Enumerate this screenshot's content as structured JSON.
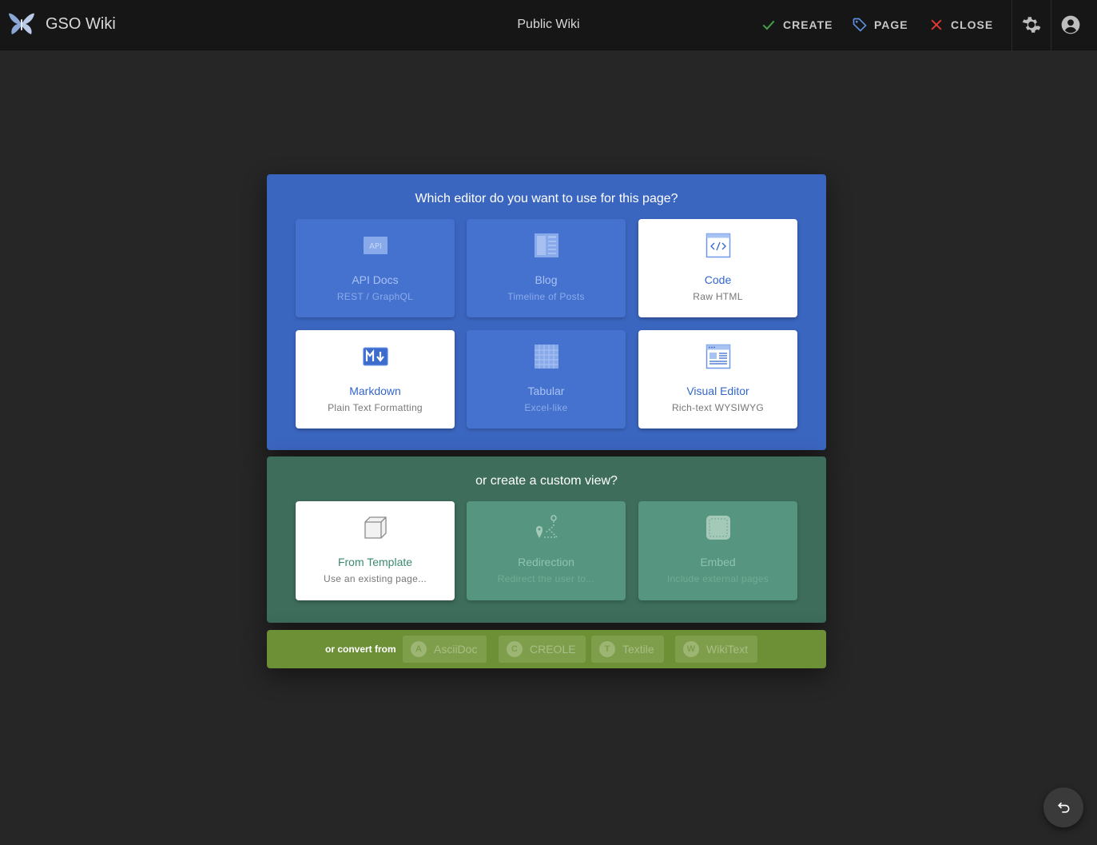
{
  "header": {
    "app_title": "GSO Wiki",
    "page_title": "Public Wiki",
    "create_label": "CREATE",
    "page_label": "PAGE",
    "close_label": "CLOSE",
    "icons": {
      "logo": "butterfly-logo",
      "create": "check-icon",
      "page": "tag-icon",
      "close": "close-icon",
      "settings": "gear-icon",
      "account": "account-circle-icon"
    },
    "colors": {
      "create": "#43a047",
      "page": "#5c8fdc",
      "close": "#e53935"
    }
  },
  "editors": {
    "heading": "Which editor do you want to use for this page?",
    "items": [
      {
        "title": "API Docs",
        "subtitle": "REST / GraphQL",
        "icon": "api-icon",
        "enabled": false
      },
      {
        "title": "Blog",
        "subtitle": "Timeline of Posts",
        "icon": "blog-icon",
        "enabled": false
      },
      {
        "title": "Code",
        "subtitle": "Raw HTML",
        "icon": "code-icon",
        "enabled": true
      },
      {
        "title": "Markdown",
        "subtitle": "Plain Text Formatting",
        "icon": "markdown-icon",
        "enabled": true
      },
      {
        "title": "Tabular",
        "subtitle": "Excel-like",
        "icon": "table-icon",
        "enabled": false
      },
      {
        "title": "Visual Editor",
        "subtitle": "Rich-text WYSIWYG",
        "icon": "visual-editor-icon",
        "enabled": true
      }
    ],
    "color": "#3b66c0"
  },
  "custom": {
    "heading": "or create a custom view?",
    "items": [
      {
        "title": "From Template",
        "subtitle": "Use an existing page...",
        "icon": "template-cube-icon",
        "enabled": true
      },
      {
        "title": "Redirection",
        "subtitle": "Redirect the user to...",
        "icon": "redirect-icon",
        "enabled": false
      },
      {
        "title": "Embed",
        "subtitle": "Include external pages",
        "icon": "embed-icon",
        "enabled": false
      }
    ],
    "color": "#3e6d5b"
  },
  "convert": {
    "label": "or convert from",
    "items": [
      {
        "badge": "A",
        "label": "AsciiDoc"
      },
      {
        "badge": "C",
        "label": "CREOLE"
      },
      {
        "badge": "T",
        "label": "Textile"
      },
      {
        "badge": "W",
        "label": "WikiText"
      }
    ],
    "color": "#6d8f36"
  },
  "fab": {
    "icon": "undo-icon"
  }
}
